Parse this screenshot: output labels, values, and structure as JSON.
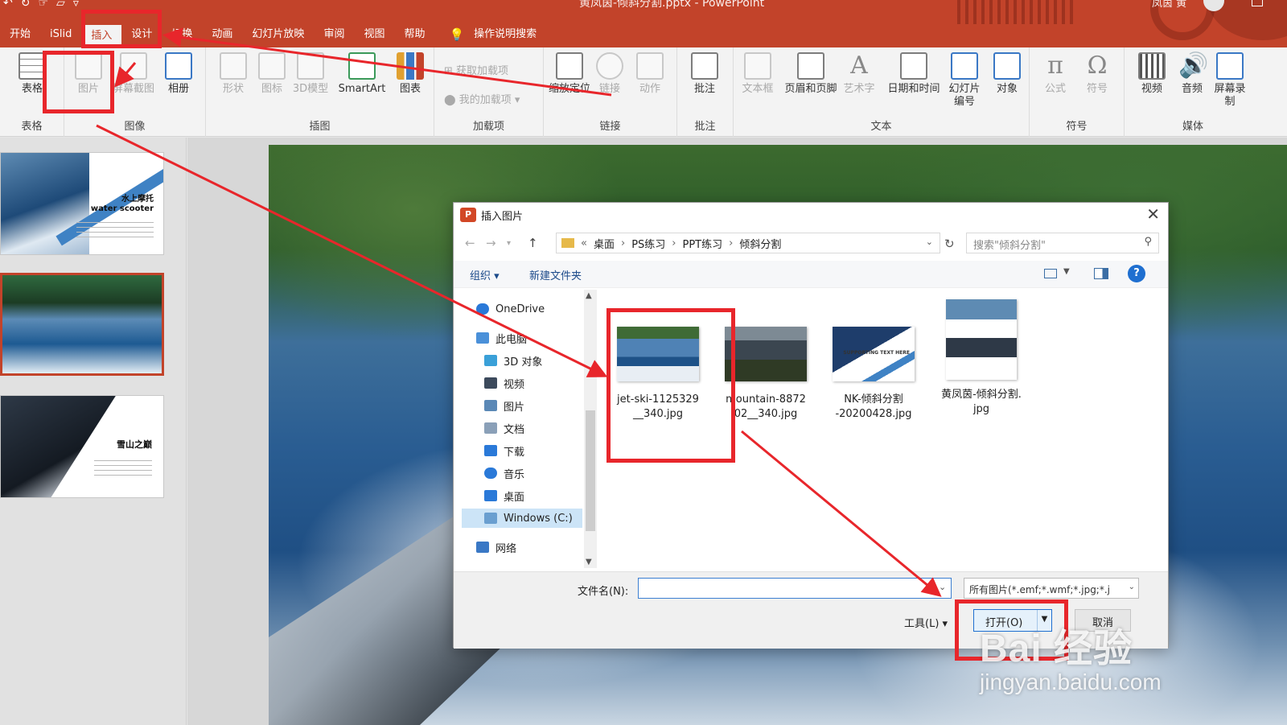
{
  "window": {
    "title": "黄凤茵-倾斜分割.pptx  -  PowerPoint",
    "user": "凤茵 黄",
    "qat_icons": [
      "undo-icon",
      "redo-icon",
      "touch-mode-icon",
      "open-folder-icon",
      "customize-qat-icon"
    ]
  },
  "menu": {
    "tabs": [
      "开始",
      "iSlid",
      "插入",
      "设计",
      "切换",
      "动画",
      "幻灯片放映",
      "审阅",
      "视图",
      "帮助"
    ],
    "active": "插入",
    "tell_me": "操作说明搜索"
  },
  "ribbon": {
    "groups": [
      {
        "label": "表格",
        "buttons": [
          "表格"
        ]
      },
      {
        "label": "图像",
        "buttons": [
          "图片",
          "屏幕截图",
          "相册"
        ]
      },
      {
        "label": "插图",
        "buttons": [
          "形状",
          "图标",
          "3D模型",
          "SmartArt",
          "图表"
        ]
      },
      {
        "label": "加载项",
        "buttons": [
          "获取加载项",
          "我的加载项"
        ]
      },
      {
        "label": "链接",
        "buttons": [
          "缩放定位",
          "链接",
          "动作"
        ]
      },
      {
        "label": "批注",
        "buttons": [
          "批注"
        ]
      },
      {
        "label": "文本",
        "buttons": [
          "文本框",
          "页眉和页脚",
          "艺术字",
          "日期和时间",
          "幻灯片编号",
          "对象"
        ]
      },
      {
        "label": "符号",
        "buttons": [
          "公式",
          "符号"
        ]
      },
      {
        "label": "媒体",
        "buttons": [
          "视频",
          "音频",
          "屏幕录制"
        ]
      }
    ],
    "icons": {
      "formula": "π",
      "symbol": "Ω",
      "wordart": "A"
    }
  },
  "slides": [
    {
      "title": "水上摩托",
      "subtitle": "water scooter"
    },
    {
      "title": ""
    },
    {
      "title": "雪山之巅"
    }
  ],
  "dialog": {
    "title": "插入图片",
    "breadcrumb": [
      "桌面",
      "PS练习",
      "PPT练习",
      "倾斜分割"
    ],
    "breadcrumb_prefix": "«",
    "search_placeholder": "搜索\"倾斜分割\"",
    "organize": "组织 ▾",
    "new_folder": "新建文件夹",
    "help": "?",
    "nav": [
      {
        "label": "OneDrive",
        "icon": "cloud-icon",
        "color": "#2a79d8"
      },
      {
        "label": "此电脑",
        "icon": "computer-icon",
        "color": "#4a90d9"
      },
      {
        "label": "3D 对象",
        "icon": "cube-icon",
        "color": "#3aa0d8"
      },
      {
        "label": "视频",
        "icon": "film-icon",
        "color": "#3c4a5c"
      },
      {
        "label": "图片",
        "icon": "picture-icon",
        "color": "#5a88b6"
      },
      {
        "label": "文档",
        "icon": "document-icon",
        "color": "#8aa0b8"
      },
      {
        "label": "下载",
        "icon": "download-icon",
        "color": "#2a79d8"
      },
      {
        "label": "音乐",
        "icon": "music-icon",
        "color": "#2a79d8"
      },
      {
        "label": "桌面",
        "icon": "desktop-icon",
        "color": "#2a79d8"
      },
      {
        "label": "Windows (C:)",
        "icon": "drive-icon",
        "color": "#6a9fd0"
      },
      {
        "label": "网络",
        "icon": "network-icon",
        "color": "#3a78c5"
      }
    ],
    "files": [
      {
        "line1": "jet-ski-1125329",
        "line2": "__340.jpg",
        "icon": "jetski-image-icon"
      },
      {
        "line1": "mountain-8872",
        "line2": "02__340.jpg",
        "icon": "mountain-image-icon"
      },
      {
        "line1": "NK-倾斜分割",
        "line2": "-20200428.jpg",
        "icon": "slide-image-icon"
      },
      {
        "line1": "黄凤茵-倾斜分割.",
        "line2": "jpg",
        "icon": "collage-image-icon"
      }
    ],
    "nk_thumb_text": "SUPPORTING TEXT HERE",
    "filename_label": "文件名(N):",
    "filename_value": "",
    "filetype": "所有图片(*.emf;*.wmf;*.jpg;*.j",
    "tools": "工具(L)",
    "open": "打开(O)",
    "cancel": "取消"
  },
  "watermark": {
    "logo": "Bai 经验",
    "url": "jingyan.baidu.com"
  },
  "colors": {
    "accent": "#c2432a",
    "annotation": "#e8262b",
    "dialog_blue": "#1f6fd0"
  }
}
